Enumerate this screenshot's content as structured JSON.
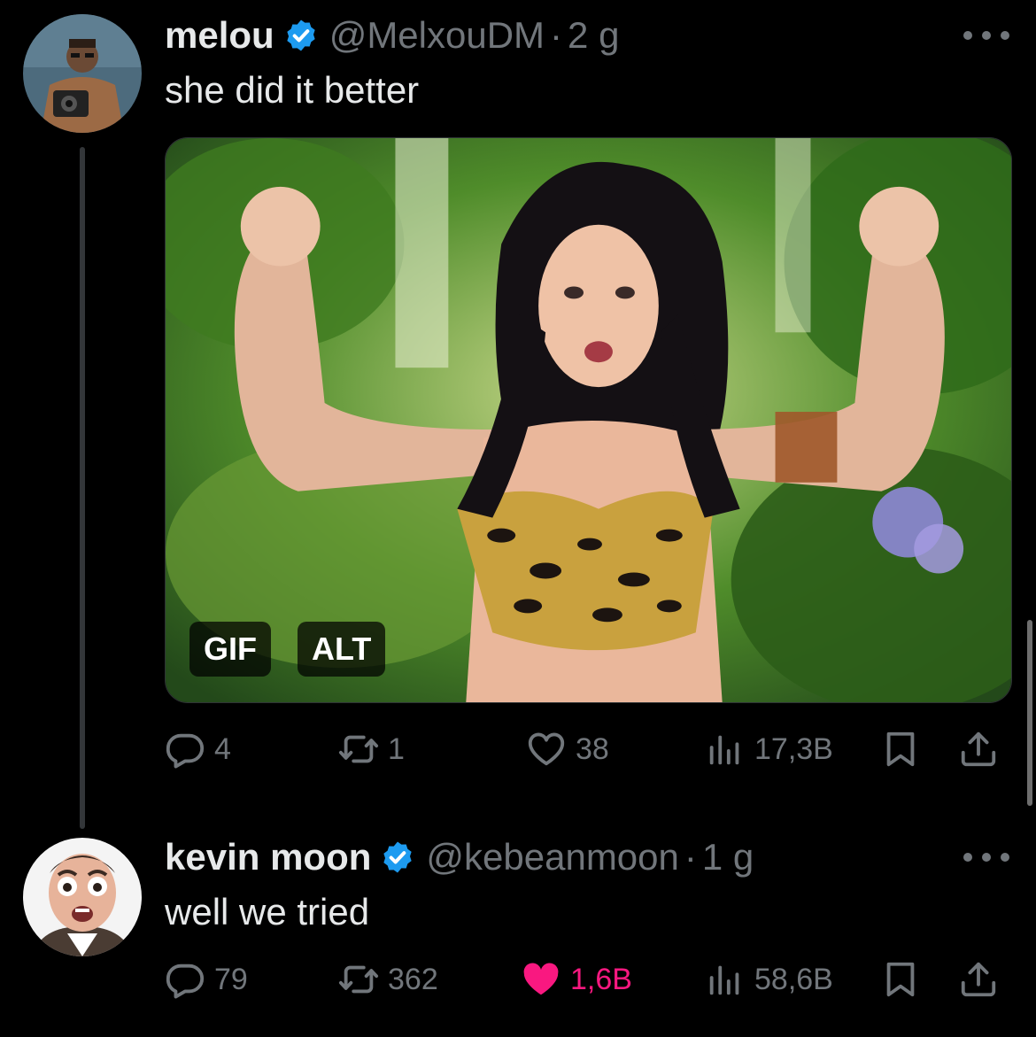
{
  "tweets": [
    {
      "display_name": "melou",
      "handle": "@MelxouDM",
      "time": "2 g",
      "text": "she did it better",
      "avatar_icon": "avatar-photo-man-with-camera",
      "media": {
        "badge_gif": "GIF",
        "badge_alt": "ALT"
      },
      "stats": {
        "replies": "4",
        "reposts": "1",
        "likes": "38",
        "views": "17,3B"
      },
      "liked": false
    },
    {
      "display_name": "kevin moon",
      "handle": "@kebeanmoon",
      "time": "1 g",
      "text": "well we tried",
      "avatar_icon": "avatar-photo-surprised-face",
      "stats": {
        "replies": "79",
        "reposts": "362",
        "likes": "1,6B",
        "views": "58,6B"
      },
      "liked": true
    }
  ],
  "separator": "·",
  "colors": {
    "background": "#000000",
    "text_primary": "#e7e9ea",
    "text_secondary": "#71767b",
    "verified_blue": "#1d9bf0",
    "like_pink": "#f91880"
  }
}
